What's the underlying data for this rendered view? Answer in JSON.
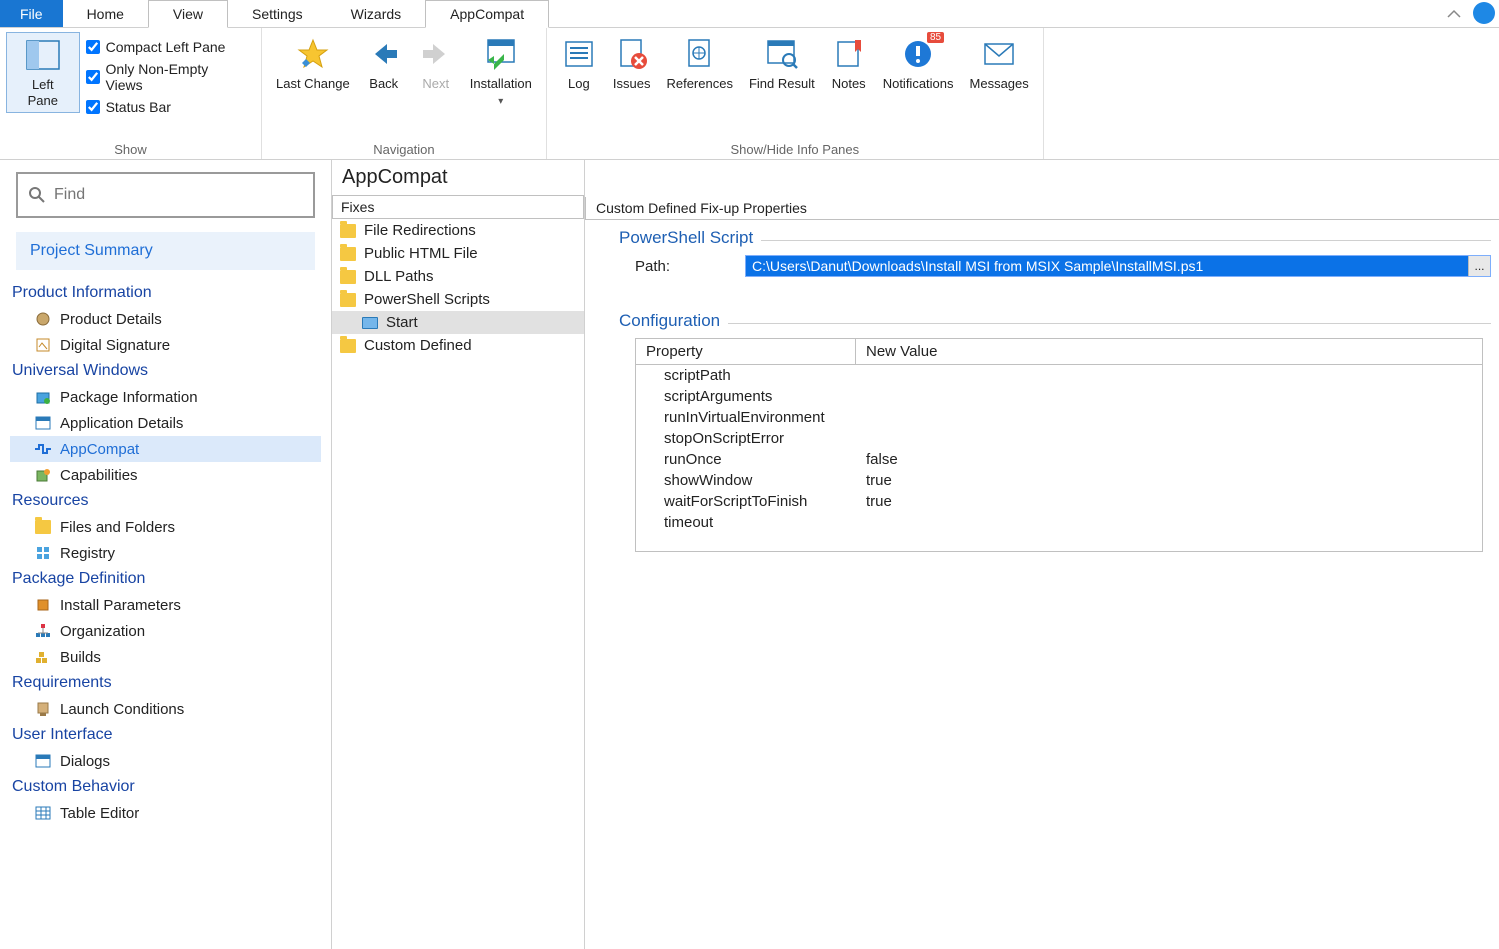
{
  "menu": {
    "file": "File",
    "home": "Home",
    "view": "View",
    "settings": "Settings",
    "wizards": "Wizards",
    "appcompat": "AppCompat"
  },
  "ribbon": {
    "show": {
      "left_pane": "Left Pane",
      "compact_left": "Compact Left Pane",
      "only_nonempty": "Only Non-Empty Views",
      "status_bar": "Status Bar",
      "group_label": "Show"
    },
    "nav": {
      "last_change": "Last Change",
      "back": "Back",
      "next": "Next",
      "installation": "Installation",
      "group_label": "Navigation"
    },
    "panes": {
      "log": "Log",
      "issues": "Issues",
      "references": "References",
      "find_result": "Find Result",
      "notes": "Notes",
      "notifications": "Notifications",
      "notif_badge": "85",
      "messages": "Messages",
      "group_label": "Show/Hide Info Panes"
    }
  },
  "search_placeholder": "Find",
  "project_summary": "Project Summary",
  "left": {
    "s1": "Product Information",
    "s1_items": [
      "Product Details",
      "Digital Signature"
    ],
    "s2": "Universal Windows",
    "s2_items": [
      "Package Information",
      "Application Details",
      "AppCompat",
      "Capabilities"
    ],
    "s3": "Resources",
    "s3_items": [
      "Files and Folders",
      "Registry"
    ],
    "s4": "Package Definition",
    "s4_items": [
      "Install Parameters",
      "Organization",
      "Builds"
    ],
    "s5": "Requirements",
    "s5_items": [
      "Launch Conditions"
    ],
    "s6": "User Interface",
    "s6_items": [
      "Dialogs"
    ],
    "s7": "Custom Behavior",
    "s7_items": [
      "Table Editor"
    ]
  },
  "mid": {
    "title": "AppCompat",
    "header": "Fixes",
    "items": [
      "File Redirections",
      "Public HTML File",
      "DLL Paths",
      "PowerShell Scripts"
    ],
    "child": "Start",
    "last": "Custom Defined"
  },
  "right": {
    "header": "Custom Defined Fix-up Properties",
    "fs1_title": "PowerShell Script",
    "path_label": "Path:",
    "path_value": "C:\\Users\\Danut\\Downloads\\Install MSI from MSIX Sample\\InstallMSI.ps1",
    "browse": "...",
    "fs2_title": "Configuration",
    "col_prop": "Property",
    "col_val": "New Value",
    "rows": [
      {
        "p": "scriptPath",
        "v": ""
      },
      {
        "p": "scriptArguments",
        "v": ""
      },
      {
        "p": "runInVirtualEnvironment",
        "v": ""
      },
      {
        "p": "stopOnScriptError",
        "v": ""
      },
      {
        "p": "runOnce",
        "v": "false"
      },
      {
        "p": "showWindow",
        "v": "true"
      },
      {
        "p": "waitForScriptToFinish",
        "v": "true"
      },
      {
        "p": "timeout",
        "v": ""
      }
    ]
  }
}
